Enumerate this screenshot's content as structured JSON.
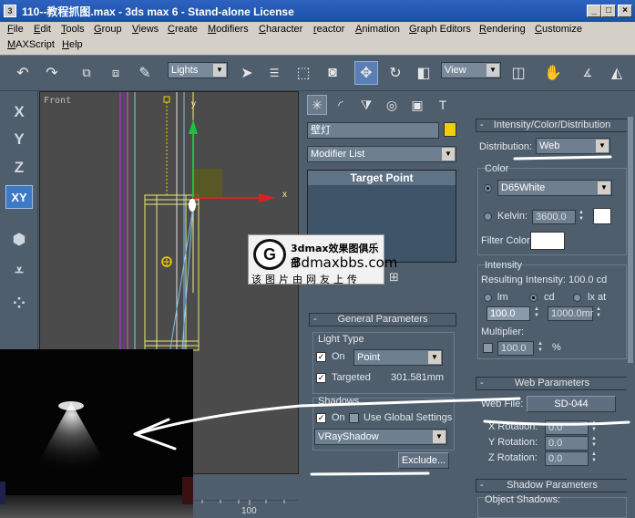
{
  "window": {
    "title": "110--教程抓图.max - 3ds max 6 - Stand-alone License",
    "buttons": [
      "_",
      "□",
      "×"
    ]
  },
  "menu": [
    "File",
    "Edit",
    "Tools",
    "Group",
    "Views",
    "Create",
    "Modifiers",
    "Character",
    "reactor",
    "Animation",
    "Graph Editors",
    "Rendering",
    "Customize",
    "MAXScript",
    "Help"
  ],
  "toolbar": {
    "selection_filter": "Lights",
    "ref_coord": "View"
  },
  "left_column": {
    "axis_x": "X",
    "axis_y": "Y",
    "axis_z": "Z",
    "axis_xy": "XY"
  },
  "viewport": {
    "label": "Front",
    "axis_y": "y",
    "axis_x": "x"
  },
  "ruler": {
    "value": "100"
  },
  "command_panel": {
    "object_name": "壁灯",
    "object_color": "#f0d000",
    "modifier_list": "Modifier List",
    "stack_item": "Target Point",
    "general_params": {
      "title": "General Parameters",
      "light_type_group": "Light Type",
      "on_label": "On",
      "type_value": "Point",
      "targeted_label": "Targeted",
      "target_distance": "301.581mm",
      "shadows_group": "Shadows",
      "shadows_on_label": "On",
      "use_global_label": "Use Global Settings",
      "shadow_type": "VRayShadow",
      "exclude_button": "Exclude..."
    }
  },
  "intensity_panel": {
    "title": "Intensity/Color/Distribution",
    "distribution_label": "Distribution:",
    "distribution_value": "Web",
    "color_group": "Color",
    "color_preset": "D65White",
    "kelvin_label": "Kelvin:",
    "kelvin_value": "3600.0",
    "filter_color_label": "Filter Color:",
    "intensity_group": "Intensity",
    "resulting_intensity": "Resulting Intensity: 100.0 cd",
    "unit_lm": "lm",
    "unit_cd": "cd",
    "unit_lx": "lx at",
    "intensity_value": "100.0",
    "distance_value": "1000.0mr",
    "multiplier_label": "Multiplier:",
    "multiplier_value": "100.0",
    "percent": "%"
  },
  "web_panel": {
    "title": "Web Parameters",
    "web_file_label": "Web File:",
    "web_file_value": "SD-044",
    "x_rot_label": "X Rotation:",
    "x_rot_value": "0.0",
    "y_rot_label": "Y Rotation:",
    "y_rot_value": "0.0",
    "z_rot_label": "Z Rotation:",
    "z_rot_value": "0.0"
  },
  "shadow_panel": {
    "title": "Shadow Parameters",
    "object_shadows": "Object Shadows:"
  },
  "watermark": {
    "line1": "3dmax效果图俱乐部",
    "line2": "3dmaxbbs.com",
    "line3": "该图片由网友上传"
  }
}
